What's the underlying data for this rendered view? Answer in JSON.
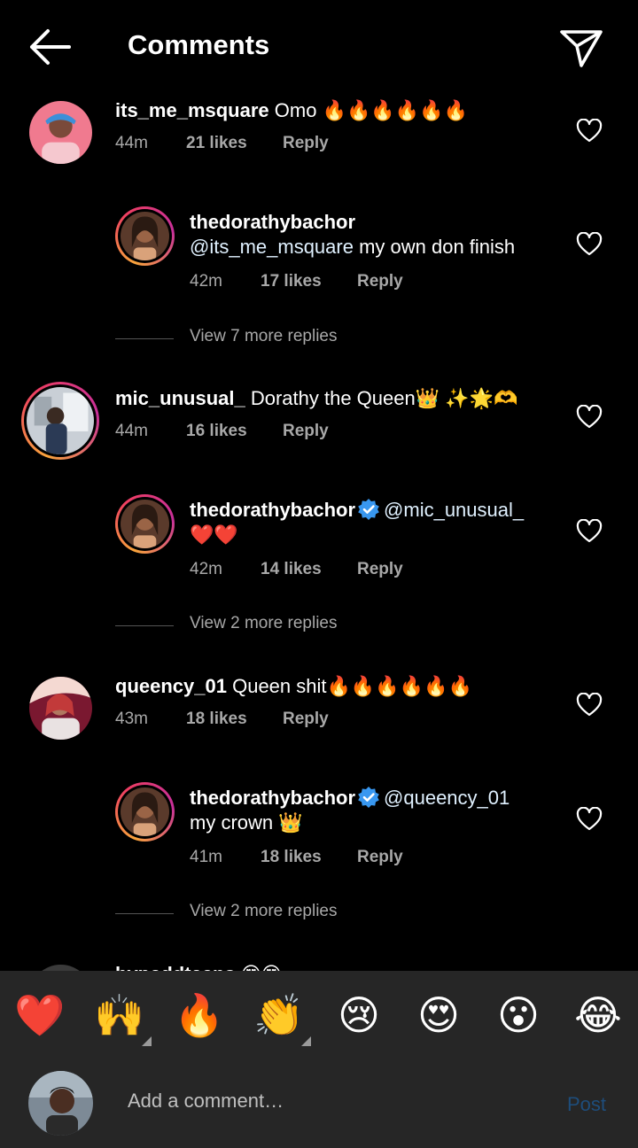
{
  "header": {
    "title": "Comments",
    "back_icon": "arrow-left-icon",
    "share_icon": "send-icon"
  },
  "comments": [
    {
      "username": "its_me_msquare",
      "text": "Omo 🔥🔥🔥🔥🔥🔥",
      "time": "44m",
      "likes": "21 likes",
      "reply": "Reply",
      "reply_item": {
        "username": "thedorathybachor",
        "mention": "@its_me_msquare",
        "text": " my own don finish",
        "time": "42m",
        "likes": "17 likes",
        "reply": "Reply"
      },
      "view_more": "View 7 more replies"
    },
    {
      "username": "mic_unusual_",
      "text": "Dorathy the Queen👑 ✨🌟🫶",
      "time": "44m",
      "likes": "16 likes",
      "reply": "Reply",
      "reply_item": {
        "username": "thedorathybachor",
        "mention": "@mic_unusual_",
        "text": "❤️❤️",
        "time": "42m",
        "likes": "14 likes",
        "reply": "Reply"
      },
      "view_more": "View 2 more replies"
    },
    {
      "username": "queency_01",
      "text": "Queen shit🔥🔥🔥🔥🔥🔥",
      "time": "43m",
      "likes": "18 likes",
      "reply": "Reply",
      "reply_item": {
        "username": "thedorathybachor",
        "mention": "@queency_01",
        "text": "my crown 👑",
        "time": "41m",
        "likes": "18 likes",
        "reply": "Reply"
      },
      "view_more": "View 2 more replies"
    }
  ],
  "partial_comment": {
    "username": "hypeddteens",
    "text": "😍😍"
  },
  "emoji_bar": [
    "❤️",
    "🙌",
    "🔥",
    "👏",
    "😢",
    "😍",
    "😮",
    "😂"
  ],
  "composer": {
    "placeholder": "Add a comment…",
    "post_label": "Post"
  },
  "colors": {
    "background": "#000000",
    "bar": "#262626",
    "secondary_text": "#a8a8a8",
    "verified": "#3897f0",
    "post_disabled": "#1e4d7b"
  }
}
